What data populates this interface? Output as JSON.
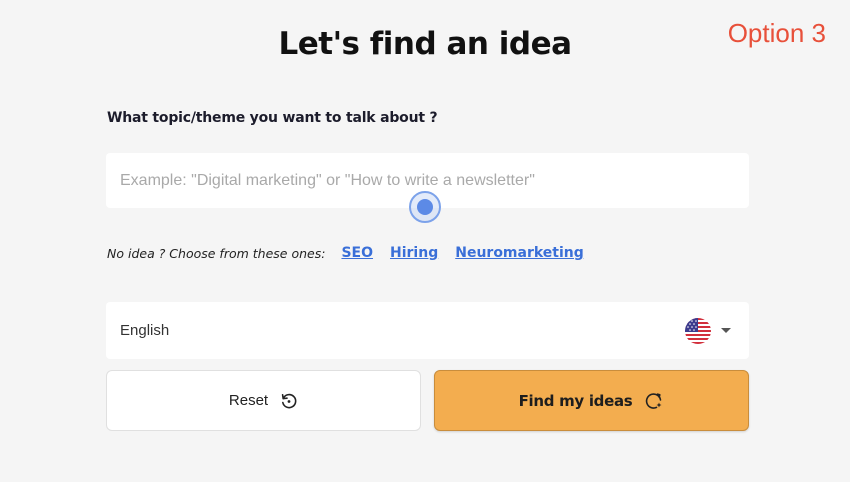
{
  "header": {
    "title": "Let's find an idea",
    "option_label": "Option 3"
  },
  "form": {
    "question": "What topic/theme you want to talk about ?",
    "topic_input": {
      "value": "",
      "placeholder": "Example: \"Digital marketing\" or \"How to write a newsletter\""
    },
    "suggestions": {
      "hint": "No idea ? Choose from these ones:",
      "items": [
        "SEO",
        "Hiring",
        "Neuromarketing"
      ]
    },
    "language": {
      "selected": "English",
      "flag_icon": "us-flag-icon",
      "caret_icon": "caret-down-icon"
    },
    "reset_button": {
      "label": "Reset",
      "icon": "reset-icon"
    },
    "find_button": {
      "label": "Find my ideas",
      "icon": "sparkle-refresh-icon"
    }
  },
  "colors": {
    "background": "#f5f5f5",
    "option_label": "#e8503a",
    "link": "#3a6fd8",
    "primary_button": "#f3ad4f",
    "cursor_indicator": "#5c8ae6"
  }
}
